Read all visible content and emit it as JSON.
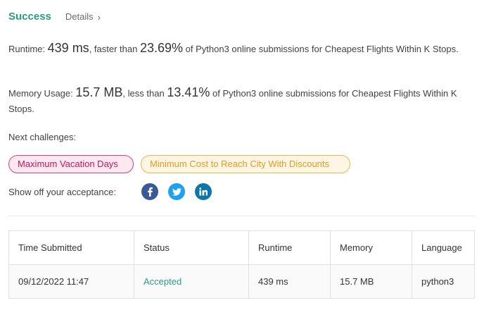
{
  "header": {
    "status": "Success",
    "details_label": "Details",
    "details_chevron": "›"
  },
  "runtime": {
    "label": "Runtime:",
    "value": "439 ms",
    "compare_text": ", faster than",
    "percent": "23.69%",
    "suffix": "of Python3 online submissions for Cheapest Flights Within K Stops."
  },
  "memory": {
    "label": "Memory Usage:",
    "value": "15.7 MB",
    "compare_text": ", less than",
    "percent": "13.41%",
    "suffix": "of Python3 online submissions for Cheapest Flights Within K Stops."
  },
  "next_challenges": {
    "label": "Next challenges:",
    "items": [
      {
        "title": "Maximum Vacation Days",
        "difficulty_color": "#d1447e"
      },
      {
        "title": "Minimum Cost to Reach City With Discounts",
        "difficulty_color": "#efb454"
      }
    ]
  },
  "share": {
    "label": "Show off your acceptance:",
    "icons": [
      "facebook-icon",
      "twitter-icon",
      "linkedin-icon"
    ],
    "colors": {
      "facebook": "#3b5998",
      "twitter": "#1da1f2",
      "linkedin": "#0e76a8"
    }
  },
  "table": {
    "headers": [
      "Time Submitted",
      "Status",
      "Runtime",
      "Memory",
      "Language"
    ],
    "rows": [
      {
        "time": "09/12/2022 11:47",
        "status": "Accepted",
        "runtime": "439 ms",
        "memory": "15.7 MB",
        "language": "python3"
      }
    ]
  },
  "colors": {
    "accent_green": "#2e9a80"
  }
}
